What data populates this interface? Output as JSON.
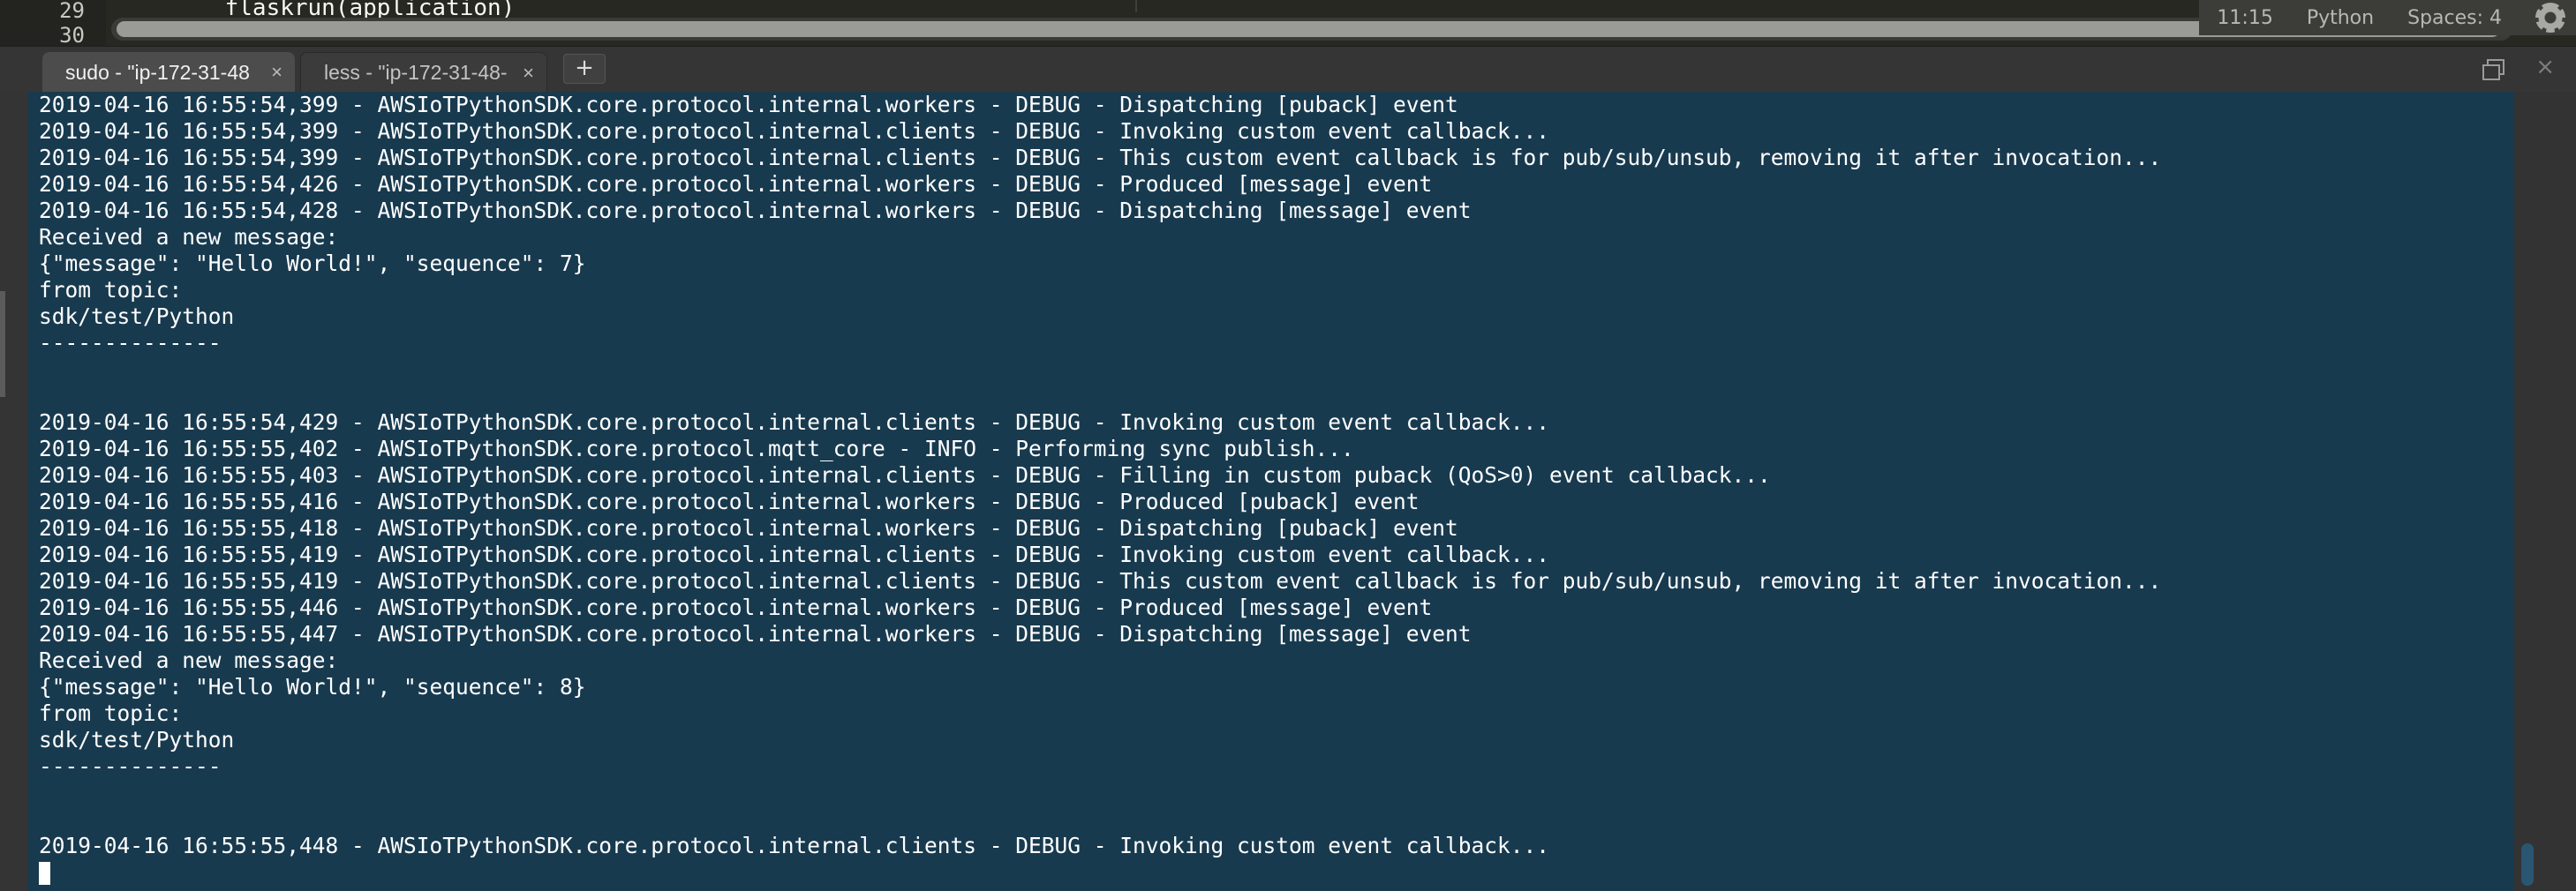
{
  "editor": {
    "line_numbers": [
      "29",
      "30"
    ],
    "code_line": "    flaskrun(application)"
  },
  "status_bar": {
    "position": "11:15",
    "syntax": "Python",
    "indent": "Spaces: 4"
  },
  "tabs": [
    {
      "label": "sudo - \"ip-172-31-48",
      "active": true
    },
    {
      "label": "less - \"ip-172-31-48-",
      "active": false
    }
  ],
  "new_tab_label": "+",
  "window_close_glyph": "×",
  "tab_close_glyph": "×",
  "colors": {
    "terminal_background": "#183a4f",
    "terminal_text": "#ffffff",
    "chrome_background": "#353535"
  },
  "terminal": {
    "lines": [
      "2019-04-16 16:55:54,399 - AWSIoTPythonSDK.core.protocol.internal.workers - DEBUG - Dispatching [puback] event",
      "2019-04-16 16:55:54,399 - AWSIoTPythonSDK.core.protocol.internal.clients - DEBUG - Invoking custom event callback...",
      "2019-04-16 16:55:54,399 - AWSIoTPythonSDK.core.protocol.internal.clients - DEBUG - This custom event callback is for pub/sub/unsub, removing it after invocation...",
      "2019-04-16 16:55:54,426 - AWSIoTPythonSDK.core.protocol.internal.workers - DEBUG - Produced [message] event",
      "2019-04-16 16:55:54,428 - AWSIoTPythonSDK.core.protocol.internal.workers - DEBUG - Dispatching [message] event",
      "Received a new message:",
      "{\"message\": \"Hello World!\", \"sequence\": 7}",
      "from topic:",
      "sdk/test/Python",
      "--------------",
      "",
      "",
      "2019-04-16 16:55:54,429 - AWSIoTPythonSDK.core.protocol.internal.clients - DEBUG - Invoking custom event callback...",
      "2019-04-16 16:55:55,402 - AWSIoTPythonSDK.core.protocol.mqtt_core - INFO - Performing sync publish...",
      "2019-04-16 16:55:55,403 - AWSIoTPythonSDK.core.protocol.internal.clients - DEBUG - Filling in custom puback (QoS>0) event callback...",
      "2019-04-16 16:55:55,416 - AWSIoTPythonSDK.core.protocol.internal.workers - DEBUG - Produced [puback] event",
      "2019-04-16 16:55:55,418 - AWSIoTPythonSDK.core.protocol.internal.workers - DEBUG - Dispatching [puback] event",
      "2019-04-16 16:55:55,419 - AWSIoTPythonSDK.core.protocol.internal.clients - DEBUG - Invoking custom event callback...",
      "2019-04-16 16:55:55,419 - AWSIoTPythonSDK.core.protocol.internal.clients - DEBUG - This custom event callback is for pub/sub/unsub, removing it after invocation...",
      "2019-04-16 16:55:55,446 - AWSIoTPythonSDK.core.protocol.internal.workers - DEBUG - Produced [message] event",
      "2019-04-16 16:55:55,447 - AWSIoTPythonSDK.core.protocol.internal.workers - DEBUG - Dispatching [message] event",
      "Received a new message:",
      "{\"message\": \"Hello World!\", \"sequence\": 8}",
      "from topic:",
      "sdk/test/Python",
      "--------------",
      "",
      "",
      "2019-04-16 16:55:55,448 - AWSIoTPythonSDK.core.protocol.internal.clients - DEBUG - Invoking custom event callback..."
    ]
  }
}
